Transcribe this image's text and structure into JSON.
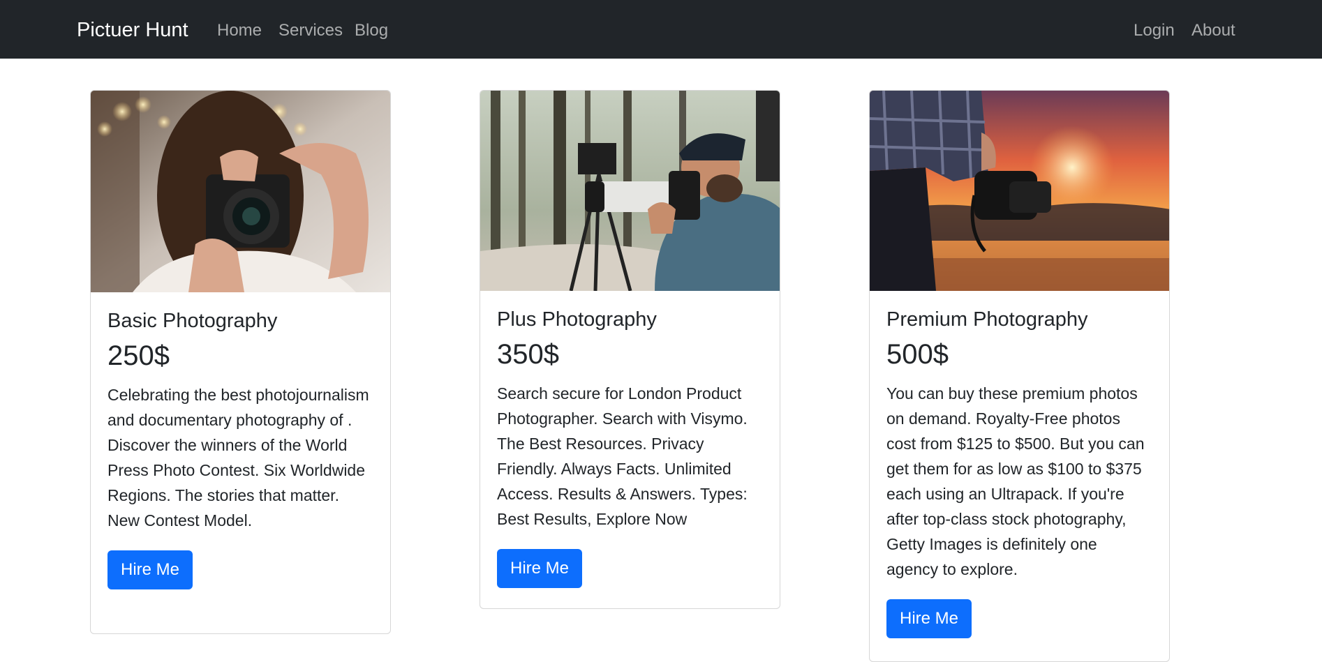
{
  "navbar": {
    "brand": "Pictuer Hunt",
    "links_left": [
      "Home",
      "Services",
      "Blog"
    ],
    "links_right": [
      "Login",
      "About"
    ]
  },
  "cards": [
    {
      "title": "Basic Photography",
      "price": "250$",
      "text": "Celebrating the best photojournalism and documentary photography of . Discover the winners of the World Press Photo Contest. Six Worldwide Regions. The stories that matter. New Contest Model.",
      "button": "Hire Me",
      "image": "photographer-woman-camera-photo"
    },
    {
      "title": "Plus Photography",
      "price": "350$",
      "text": "Search secure for London Product Photographer. Search with Visymo. The Best Resources. Privacy Friendly. Always Facts. Unlimited Access. Results & Answers. Types: Best Results, Explore Now",
      "button": "Hire Me",
      "image": "photographer-man-forest-photo"
    },
    {
      "title": "Premium Photography",
      "price": "500$",
      "text": "You can buy these premium photos on demand. Royalty-Free photos cost from $125 to $500. But you can get them for as low as $100 to $375 each using an Ultrapack. If you're after top-class stock photography, Getty Images is definitely one agency to explore.",
      "button": "Hire Me",
      "image": "camera-sunset-photo"
    }
  ],
  "colors": {
    "navbar_bg": "#212529",
    "button_bg": "#0d6efd",
    "text": "#212529"
  }
}
